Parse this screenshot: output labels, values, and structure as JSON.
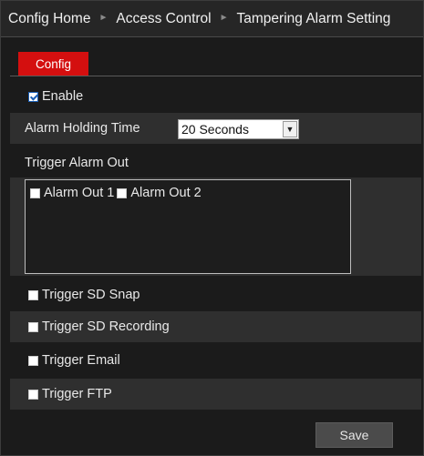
{
  "breadcrumb": {
    "items": [
      "Config Home",
      "Access Control",
      "Tampering Alarm Setting"
    ],
    "separator": "►"
  },
  "tabs": [
    {
      "label": "Config",
      "active": true
    }
  ],
  "enable": {
    "label": "Enable",
    "checked": true
  },
  "alarm_holding_time": {
    "label": "Alarm Holding Time",
    "value": "20 Seconds"
  },
  "trigger_alarm_out": {
    "label": "Trigger Alarm Out",
    "items": [
      {
        "label": "Alarm Out 1",
        "checked": false
      },
      {
        "label": "Alarm Out 2",
        "checked": false
      }
    ]
  },
  "triggers": {
    "sd_snap": {
      "label": "Trigger SD Snap",
      "checked": false
    },
    "sd_recording": {
      "label": "Trigger SD Recording",
      "checked": false
    },
    "email": {
      "label": "Trigger Email",
      "checked": false
    },
    "ftp": {
      "label": "Trigger FTP",
      "checked": false
    }
  },
  "save_label": "Save",
  "colors": {
    "accent": "#d40f0f",
    "background": "#1b1b1b",
    "row_shade": "#2f2f2f"
  }
}
